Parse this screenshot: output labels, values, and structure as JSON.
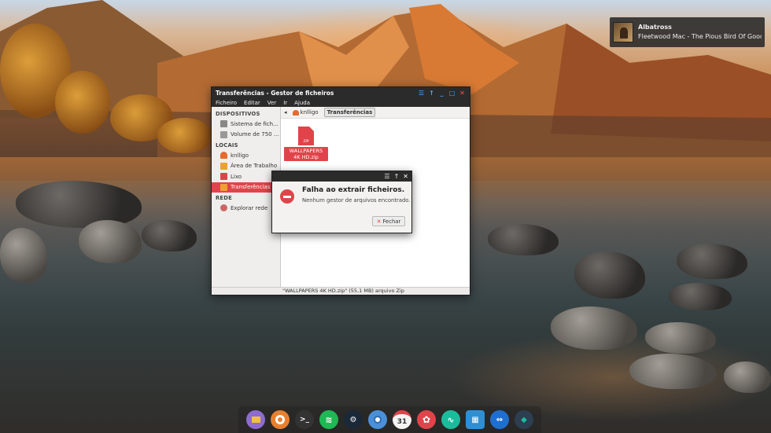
{
  "notification": {
    "title": "Albatross",
    "body": "Fleetwood Mac - The Pious Bird Of Good Omen"
  },
  "file_manager": {
    "title": "Transferências - Gestor de ficheiros",
    "menu": [
      "Ficheiro",
      "Editar",
      "Ver",
      "Ir",
      "Ajuda"
    ],
    "sidebar": {
      "devices_header": "DISPOSITIVOS",
      "devices": [
        "Sistema de fich...",
        "Volume de 750 ..."
      ],
      "places_header": "LOCAIS",
      "places": [
        "knlligo",
        "Área de Trabalho",
        "Lixo",
        "Transferências"
      ],
      "network_header": "REDE",
      "network": [
        "Explorar rede"
      ]
    },
    "pathbar": {
      "home": "knlligo",
      "current": "Transferências"
    },
    "file": {
      "name": "WALLPAPERS 4K HD.zip",
      "icon_label": "ZIP"
    },
    "statusbar": "\"WALLPAPERS 4K HD.zip\" (55,1 MB) arquivo Zip"
  },
  "error_dialog": {
    "title": "Falha ao extrair ficheiros.",
    "message": "Nenhum gestor de arquivos encontrado.",
    "button": "Fechar"
  },
  "dock": {
    "calendar_day": "31",
    "apps": [
      "files-icon",
      "audio-player-icon",
      "terminal-icon",
      "spotify-icon",
      "steam-icon",
      "chrome-icon",
      "calendar-icon",
      "settings-icon",
      "system-monitor-icon",
      "screenshot-icon",
      "teamviewer-icon",
      "kodi-icon"
    ]
  },
  "colors": {
    "accent_red": "#e0444a",
    "titlebar": "#2b2b2b",
    "window_button_blue": "#49a8ff"
  }
}
